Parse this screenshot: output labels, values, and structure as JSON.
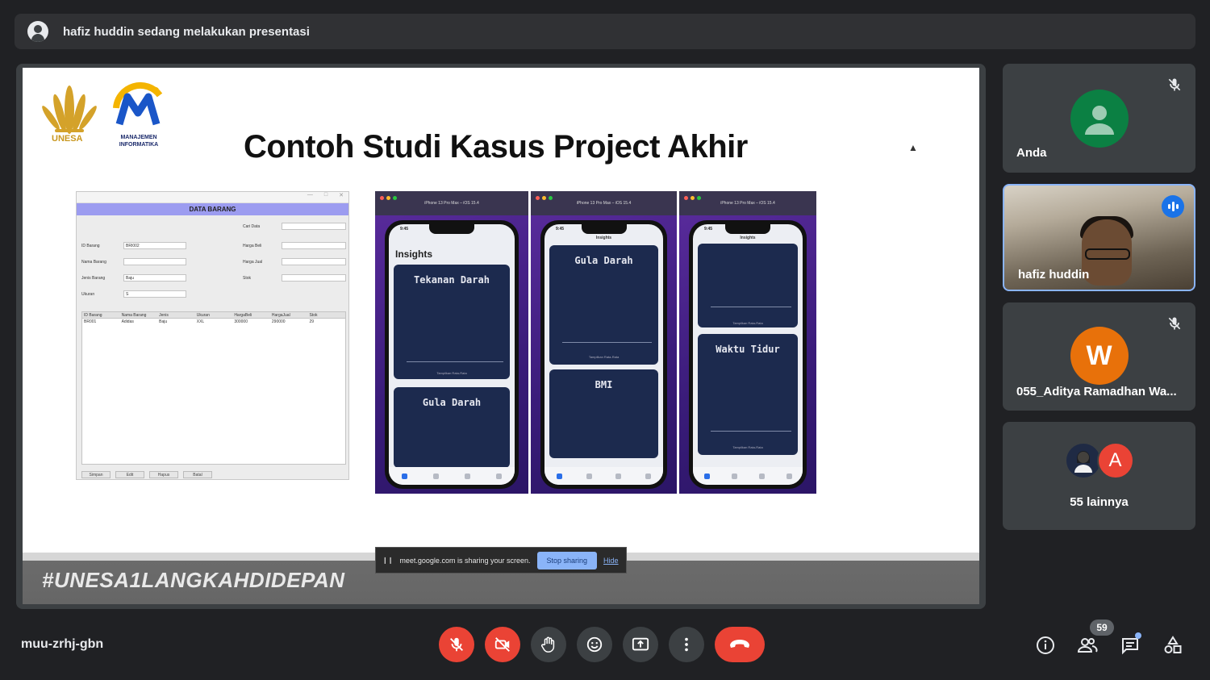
{
  "topbar": {
    "presenting_text": "hafiz huddin sedang melakukan presentasi"
  },
  "slide": {
    "title": "Contoh Studi Kasus Project Akhir",
    "logo_left_text": "UNESA",
    "logo_right_text": "MANAJEMEN INFORMATIKA",
    "hashtag": "#UNESA1LANGKAHDIDEPAN",
    "desktop_app": {
      "header": "DATA BARANG",
      "fields": [
        "Cari Data",
        "ID Barang",
        "Nama Barang",
        "Jenis Barang",
        "Ukuran",
        "Harga Beli",
        "Harga Jual",
        "Stok"
      ],
      "values": {
        "id_barang": "BRI002",
        "jenis_barang": "Baju",
        "ukuran": "S"
      },
      "table_headers": [
        "ID Barang",
        "Nama Barang",
        "Jenis",
        "Ukuran",
        "HargaBeli",
        "HargaJual",
        "Stok"
      ],
      "table_rows": [
        [
          "BR001",
          "Adidas",
          "Baju",
          "XXL",
          "300000",
          "290000",
          "29"
        ]
      ],
      "buttons": [
        "Simpan",
        "Edit",
        "Hapus",
        "Batal"
      ]
    },
    "phones": [
      {
        "bar_title": "iPhone 13 Pro Max – iOS 15.4",
        "time": "9:45",
        "header": "Insights",
        "cards": [
          "Tekanan Darah",
          "Gula Darah"
        ]
      },
      {
        "bar_title": "iPhone 13 Pro Max – iOS 15.4",
        "time": "9:45",
        "header": "Insights",
        "cards": [
          "Gula Darah",
          "BMI"
        ]
      },
      {
        "bar_title": "iPhone 13 Pro Max – iOS 15.4",
        "time": "9:45",
        "header": "Insights",
        "cards": [
          "",
          "Waktu Tidur"
        ]
      }
    ],
    "chart_footer": "Tampilkan Rata-Rata"
  },
  "share_bar": {
    "message": "meet.google.com is sharing your screen.",
    "stop_label": "Stop sharing",
    "hide_label": "Hide"
  },
  "participants": [
    {
      "name": "Anda",
      "muted": true,
      "avatar_color": "#0b8043"
    },
    {
      "name": "hafiz huddin",
      "speaking": true
    },
    {
      "name": "055_Aditya Ramadhan Wa...",
      "initial": "W",
      "muted": true,
      "avatar_color": "#e8710a"
    },
    {
      "name": "55 lainnya",
      "initial": "A",
      "avatar_color": "#ea4335"
    }
  ],
  "bottombar": {
    "meeting_code": "muu-zrhj-gbn",
    "participant_count": "59"
  },
  "colors": {
    "danger": "#ea4335",
    "accent": "#8ab4f8",
    "surface": "#3c4043",
    "background": "#202124"
  }
}
